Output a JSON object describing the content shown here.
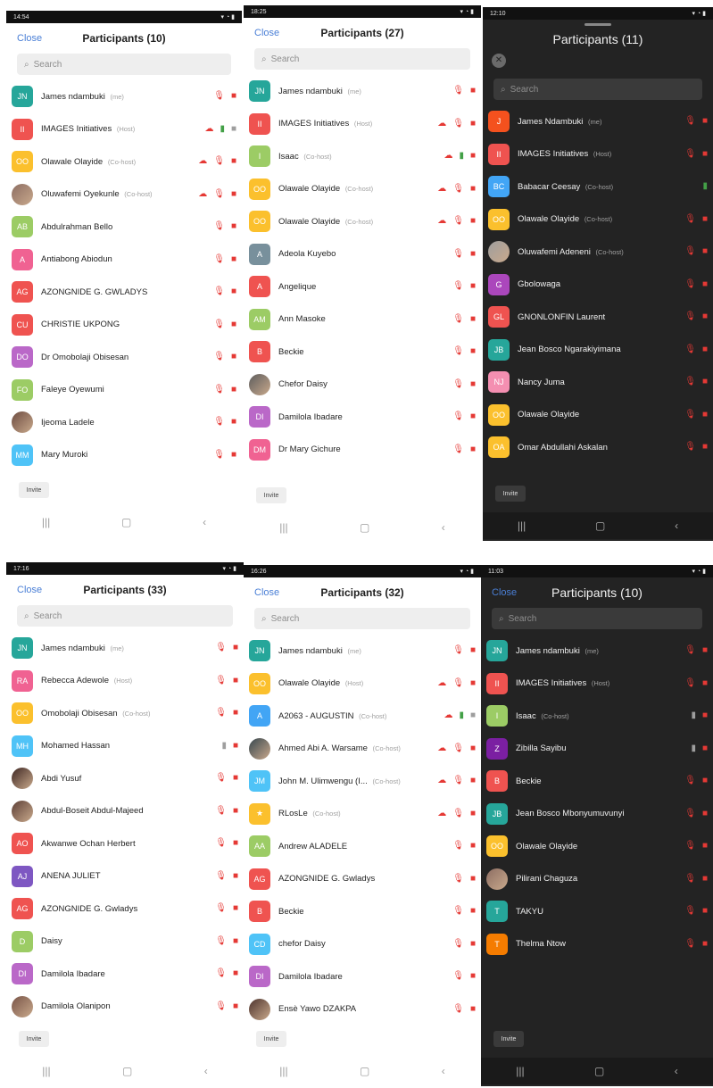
{
  "panels": [
    {
      "theme": "light",
      "status_time": "14:54",
      "close": "Close",
      "title": "Participants (10)",
      "search": "Search",
      "invite": "Invite",
      "rows": [
        {
          "initials": "JN",
          "color": "#26a69a",
          "name": "James ndambuki",
          "tag": "(me)",
          "icons": [
            "mic-off",
            "cam-off"
          ]
        },
        {
          "initials": "II",
          "color": "#ef5350",
          "name": "IMAGES Initiatives",
          "tag": "(Host)",
          "icons": [
            "cloud",
            "mic-on",
            "cam-gray"
          ]
        },
        {
          "initials": "OO",
          "color": "#fbc02d",
          "name": "Olawale Olayide",
          "tag": "(Co-host)",
          "icons": [
            "cloud",
            "mic-off",
            "cam-off"
          ]
        },
        {
          "initials": "",
          "color": "#8d6e63",
          "photo": true,
          "name": "Oluwafemi Oyekunle",
          "tag": "(Co-host)",
          "icons": [
            "cloud",
            "mic-off",
            "cam-off"
          ]
        },
        {
          "initials": "AB",
          "color": "#9ccc65",
          "name": "Abdulrahman Bello",
          "tag": "",
          "icons": [
            "mic-off",
            "cam-off"
          ]
        },
        {
          "initials": "A",
          "color": "#f06292",
          "name": "Antiabong Abiodun",
          "tag": "",
          "icons": [
            "mic-off",
            "cam-off"
          ]
        },
        {
          "initials": "AG",
          "color": "#ef5350",
          "name": "AZONGNIDE G. GWLADYS",
          "tag": "",
          "icons": [
            "mic-off",
            "cam-off"
          ]
        },
        {
          "initials": "CU",
          "color": "#ef5350",
          "name": "CHRISTIE UKPONG",
          "tag": "",
          "icons": [
            "mic-off",
            "cam-off"
          ]
        },
        {
          "initials": "DO",
          "color": "#ba68c8",
          "name": "Dr Omobolaji Obisesan",
          "tag": "",
          "icons": [
            "mic-off",
            "cam-off"
          ]
        },
        {
          "initials": "FO",
          "color": "#9ccc65",
          "name": "Faleye Oyewumi",
          "tag": "",
          "icons": [
            "mic-off",
            "cam-off"
          ]
        },
        {
          "initials": "",
          "color": "#6d4c41",
          "photo": true,
          "name": "Ijeoma Ladele",
          "tag": "",
          "icons": [
            "mic-off",
            "cam-off"
          ]
        },
        {
          "initials": "MM",
          "color": "#4fc3f7",
          "name": "Mary Muroki",
          "tag": "",
          "icons": [
            "mic-off",
            "cam-off"
          ]
        }
      ]
    },
    {
      "theme": "light",
      "status_time": "18:25",
      "close": "Close",
      "title": "Participants (27)",
      "search": "Search",
      "invite": "Invite",
      "rows": [
        {
          "initials": "JN",
          "color": "#26a69a",
          "name": "James ndambuki",
          "tag": "(me)",
          "icons": [
            "mic-off",
            "cam-off"
          ]
        },
        {
          "initials": "II",
          "color": "#ef5350",
          "name": "IMAGES Initiatives",
          "tag": "(Host)",
          "icons": [
            "cloud",
            "mic-off",
            "cam-off"
          ]
        },
        {
          "initials": "I",
          "color": "#9ccc65",
          "name": "Isaac",
          "tag": "(Co-host)",
          "icons": [
            "cloud",
            "mic-on",
            "cam-off"
          ]
        },
        {
          "initials": "OO",
          "color": "#fbc02d",
          "name": "Olawale Olayide",
          "tag": "(Co-host)",
          "icons": [
            "cloud",
            "mic-off",
            "cam-off"
          ]
        },
        {
          "initials": "OO",
          "color": "#fbc02d",
          "name": "Olawale Olayide",
          "tag": "(Co-host)",
          "icons": [
            "cloud",
            "mic-off",
            "cam-off"
          ]
        },
        {
          "initials": "A",
          "color": "#78909c",
          "name": "Adeola Kuyebo",
          "tag": "",
          "icons": [
            "mic-off",
            "cam-off"
          ]
        },
        {
          "initials": "A",
          "color": "#ef5350",
          "name": "Angelique",
          "tag": "",
          "icons": [
            "mic-off",
            "cam-off"
          ]
        },
        {
          "initials": "AM",
          "color": "#9ccc65",
          "name": "Ann Masoke",
          "tag": "",
          "icons": [
            "mic-off",
            "cam-off"
          ]
        },
        {
          "initials": "B",
          "color": "#ef5350",
          "name": "Beckie",
          "tag": "",
          "icons": [
            "mic-off",
            "cam-off"
          ]
        },
        {
          "initials": "",
          "color": "#5d5d5d",
          "photo": true,
          "name": "Chefor Daisy",
          "tag": "",
          "icons": [
            "mic-off",
            "cam-off"
          ]
        },
        {
          "initials": "DI",
          "color": "#ba68c8",
          "name": "Damilola Ibadare",
          "tag": "",
          "icons": [
            "mic-off",
            "cam-off"
          ]
        },
        {
          "initials": "DM",
          "color": "#f06292",
          "name": "Dr Mary Gichure",
          "tag": "",
          "icons": [
            "mic-off",
            "cam-off"
          ]
        }
      ]
    },
    {
      "theme": "dark",
      "status_time": "12:10",
      "close": "",
      "title": "Participants (11)",
      "search": "Search",
      "invite": "Invite",
      "rows": [
        {
          "initials": "J",
          "color": "#f4511e",
          "name": "James Ndambuki",
          "tag": "(me)",
          "icons": [
            "mic-off",
            "cam-off"
          ]
        },
        {
          "initials": "II",
          "color": "#ef5350",
          "name": "IMAGES Initiatives",
          "tag": "(Host)",
          "icons": [
            "mic-off",
            "cam-off"
          ]
        },
        {
          "initials": "BC",
          "color": "#42a5f5",
          "name": "Babacar Ceesay",
          "tag": "(Co-host)",
          "icons": [
            "mic-on"
          ]
        },
        {
          "initials": "OO",
          "color": "#fbc02d",
          "name": "Olawale Olayide",
          "tag": "(Co-host)",
          "icons": [
            "mic-off",
            "cam-off"
          ]
        },
        {
          "initials": "",
          "color": "#9e9e9e",
          "photo": true,
          "name": "Oluwafemi Adeneni",
          "tag": "(Co-host)",
          "icons": [
            "mic-off",
            "cam-off"
          ]
        },
        {
          "initials": "G",
          "color": "#ab47bc",
          "name": "Gbolowaga",
          "tag": "",
          "icons": [
            "mic-off",
            "cam-off"
          ]
        },
        {
          "initials": "GL",
          "color": "#ef5350",
          "name": "GNONLONFIN Laurent",
          "tag": "",
          "icons": [
            "mic-off",
            "cam-off"
          ]
        },
        {
          "initials": "JB",
          "color": "#26a69a",
          "name": "Jean Bosco Ngarakiyimana",
          "tag": "",
          "icons": [
            "mic-off",
            "cam-off"
          ]
        },
        {
          "initials": "NJ",
          "color": "#f48fb1",
          "name": "Nancy Juma",
          "tag": "",
          "icons": [
            "mic-off",
            "cam-off"
          ]
        },
        {
          "initials": "OO",
          "color": "#fbc02d",
          "name": "Olawale Olayide",
          "tag": "",
          "icons": [
            "mic-off",
            "cam-off"
          ]
        },
        {
          "initials": "OA",
          "color": "#fbc02d",
          "name": "Omar Abdullahi Askalan",
          "tag": "",
          "icons": [
            "mic-off",
            "cam-off"
          ]
        }
      ]
    },
    {
      "theme": "light",
      "status_time": "17:16",
      "close": "Close",
      "title": "Participants (33)",
      "search": "Search",
      "invite": "Invite",
      "rows": [
        {
          "initials": "JN",
          "color": "#26a69a",
          "name": "James ndambuki",
          "tag": "(me)",
          "icons": [
            "mic-off",
            "cam-off"
          ]
        },
        {
          "initials": "RA",
          "color": "#f06292",
          "name": "Rebecca Adewole",
          "tag": "(Host)",
          "icons": [
            "mic-off",
            "cam-off"
          ]
        },
        {
          "initials": "OO",
          "color": "#fbc02d",
          "name": "Omobolaji Obisesan",
          "tag": "(Co-host)",
          "icons": [
            "mic-off",
            "cam-off"
          ]
        },
        {
          "initials": "MH",
          "color": "#4fc3f7",
          "name": "Mohamed Hassan",
          "tag": "",
          "icons": [
            "mic-gray",
            "cam-off"
          ]
        },
        {
          "initials": "",
          "color": "#3e2723",
          "photo": true,
          "name": "Abdi Yusuf",
          "tag": "",
          "icons": [
            "mic-off",
            "cam-off"
          ]
        },
        {
          "initials": "",
          "color": "#5d4037",
          "photo": true,
          "name": "Abdul-Boseit Abdul-Majeed",
          "tag": "",
          "icons": [
            "mic-off",
            "cam-off"
          ]
        },
        {
          "initials": "AO",
          "color": "#ef5350",
          "name": "Akwanwe Ochan Herbert",
          "tag": "",
          "icons": [
            "mic-off",
            "cam-off"
          ]
        },
        {
          "initials": "AJ",
          "color": "#7e57c2",
          "name": "ANENA JULIET",
          "tag": "",
          "icons": [
            "mic-off",
            "cam-off"
          ]
        },
        {
          "initials": "AG",
          "color": "#ef5350",
          "name": "AZONGNIDE G. Gwladys",
          "tag": "",
          "icons": [
            "mic-off",
            "cam-off"
          ]
        },
        {
          "initials": "D",
          "color": "#9ccc65",
          "name": "Daisy",
          "tag": "",
          "icons": [
            "mic-off",
            "cam-off"
          ]
        },
        {
          "initials": "DI",
          "color": "#ba68c8",
          "name": "Damilola Ibadare",
          "tag": "",
          "icons": [
            "mic-off",
            "cam-off"
          ]
        },
        {
          "initials": "",
          "color": "#795548",
          "photo": true,
          "name": "Damilola Olanipon",
          "tag": "",
          "icons": [
            "mic-off",
            "cam-off"
          ]
        }
      ]
    },
    {
      "theme": "light",
      "status_time": "16:26",
      "close": "Close",
      "title": "Participants (32)",
      "search": "Search",
      "invite": "Invite",
      "rows": [
        {
          "initials": "JN",
          "color": "#26a69a",
          "name": "James ndambuki",
          "tag": "(me)",
          "icons": [
            "mic-off",
            "cam-off"
          ]
        },
        {
          "initials": "OO",
          "color": "#fbc02d",
          "name": "Olawale Olayide",
          "tag": "(Host)",
          "icons": [
            "cloud",
            "mic-off",
            "cam-off"
          ]
        },
        {
          "initials": "A",
          "color": "#42a5f5",
          "name": "A2063 - AUGUSTIN",
          "tag": "(Co-host)",
          "icons": [
            "cloud",
            "mic-on",
            "cam-gray"
          ]
        },
        {
          "initials": "",
          "color": "#37474f",
          "photo": true,
          "name": "Ahmed Abi A. Warsame",
          "tag": "(Co-host)",
          "icons": [
            "cloud",
            "mic-off",
            "cam-off"
          ]
        },
        {
          "initials": "JM",
          "color": "#4fc3f7",
          "name": "John M. Ulimwengu (I...",
          "tag": "(Co-host)",
          "icons": [
            "cloud",
            "mic-off",
            "cam-off"
          ]
        },
        {
          "initials": "★",
          "color": "#fbc02d",
          "name": "RLosLe",
          "tag": "(Co-host)",
          "icons": [
            "cloud",
            "mic-off",
            "cam-off"
          ]
        },
        {
          "initials": "AA",
          "color": "#9ccc65",
          "name": "Andrew ALADELE",
          "tag": "",
          "icons": [
            "mic-off",
            "cam-off"
          ]
        },
        {
          "initials": "AG",
          "color": "#ef5350",
          "name": "AZONGNIDE G. Gwladys",
          "tag": "",
          "icons": [
            "mic-off",
            "cam-off"
          ]
        },
        {
          "initials": "B",
          "color": "#ef5350",
          "name": "Beckie",
          "tag": "",
          "icons": [
            "mic-off",
            "cam-off"
          ]
        },
        {
          "initials": "CD",
          "color": "#4fc3f7",
          "name": "chefor Daisy",
          "tag": "",
          "icons": [
            "mic-off",
            "cam-off"
          ]
        },
        {
          "initials": "DI",
          "color": "#ba68c8",
          "name": "Damilola Ibadare",
          "tag": "",
          "icons": [
            "mic-off",
            "cam-off"
          ]
        },
        {
          "initials": "",
          "color": "#4e342e",
          "photo": true,
          "name": "Ensè Yawo DZAKPA",
          "tag": "",
          "icons": [
            "mic-off",
            "cam-off"
          ]
        }
      ]
    },
    {
      "theme": "dark",
      "status_time": "11:03",
      "close": "Close",
      "title": "Participants (10)",
      "search": "Search",
      "invite": "Invite",
      "rows": [
        {
          "initials": "JN",
          "color": "#26a69a",
          "name": "James ndambuki",
          "tag": "(me)",
          "icons": [
            "mic-off",
            "cam-off"
          ]
        },
        {
          "initials": "II",
          "color": "#ef5350",
          "name": "IMAGES Initiatives",
          "tag": "(Host)",
          "icons": [
            "mic-off",
            "cam-off"
          ]
        },
        {
          "initials": "I",
          "color": "#9ccc65",
          "name": "Isaac",
          "tag": "(Co-host)",
          "icons": [
            "mic-gray",
            "cam-off"
          ]
        },
        {
          "initials": "Z",
          "color": "#7b1fa2",
          "name": "Zibilla Sayibu",
          "tag": "",
          "icons": [
            "mic-gray",
            "cam-off"
          ]
        },
        {
          "initials": "B",
          "color": "#ef5350",
          "name": "Beckie",
          "tag": "",
          "icons": [
            "mic-off",
            "cam-off"
          ]
        },
        {
          "initials": "JB",
          "color": "#26a69a",
          "name": "Jean Bosco Mbonyumuvunyi",
          "tag": "",
          "icons": [
            "mic-off",
            "cam-off"
          ]
        },
        {
          "initials": "OO",
          "color": "#fbc02d",
          "name": "Olawale Olayide",
          "tag": "",
          "icons": [
            "mic-off",
            "cam-off"
          ]
        },
        {
          "initials": "",
          "color": "#8d6e63",
          "photo": true,
          "name": "Pilirani Chaguza",
          "tag": "",
          "icons": [
            "mic-off",
            "cam-off"
          ]
        },
        {
          "initials": "T",
          "color": "#26a69a",
          "name": "TAKYU",
          "tag": "",
          "icons": [
            "mic-off",
            "cam-off"
          ]
        },
        {
          "initials": "T",
          "color": "#f57c00",
          "name": "Thelma Ntow",
          "tag": "",
          "icons": [
            "mic-off",
            "cam-off"
          ]
        }
      ]
    }
  ]
}
